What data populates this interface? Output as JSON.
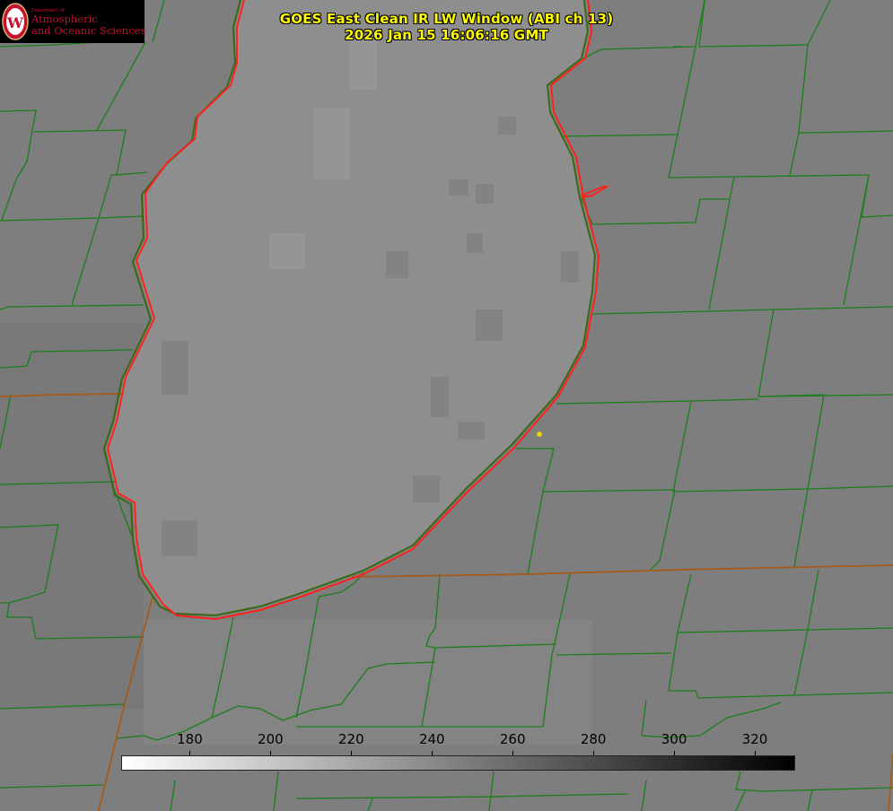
{
  "title": {
    "line1": "GOES East Clean IR LW Window (ABI ch 13)",
    "line2": "2026 Jan 15 16:06:16 GMT"
  },
  "logo": {
    "small_text": "Department of",
    "line1": "Atmospheric",
    "line2": "and Oceanic Sciences",
    "seal_letter": "W"
  },
  "colorbar": {
    "min": 163,
    "max": 330,
    "ticks": [
      "180",
      "200",
      "220",
      "240",
      "260",
      "280",
      "300",
      "320"
    ],
    "ramp": [
      "#ffffff",
      "#000000"
    ]
  },
  "colors": {
    "background": "#7e7e7e",
    "lake": "#8e8e8e",
    "county_lines": "#1a7f1a",
    "state_lines": "#a65a1a",
    "coastline": "#ff2020",
    "title_text": "#ffff00",
    "marker": "#e6d200"
  }
}
